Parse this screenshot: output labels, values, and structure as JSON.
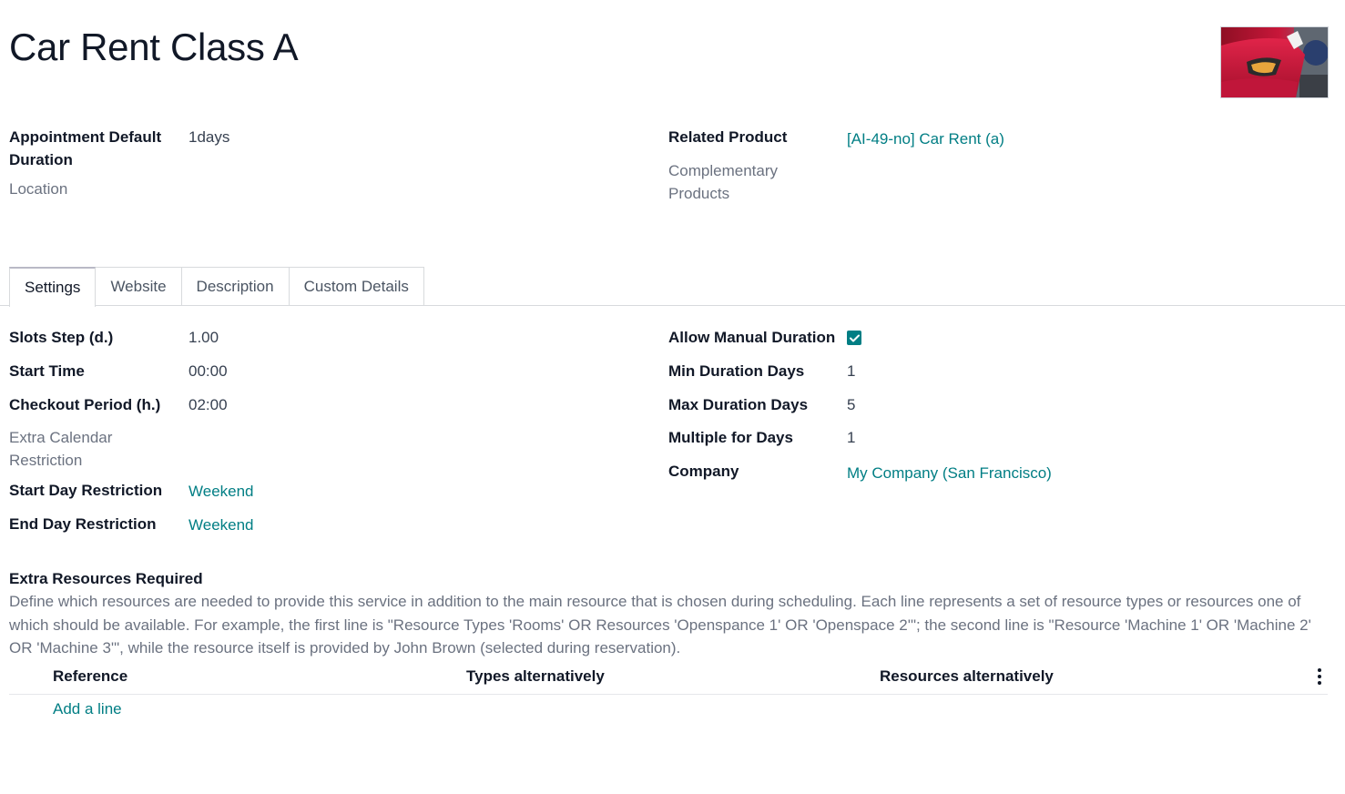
{
  "record": {
    "title": "Car Rent Class A"
  },
  "header_fields": {
    "appointment_default_duration_label": "Appointment Default Duration",
    "appointment_default_duration_value": "1days",
    "location_label": "Location",
    "related_product_label": "Related Product",
    "related_product_value": "[AI-49-no] Car Rent (a)",
    "complementary_products_label": "Complementary Products"
  },
  "tabs": [
    {
      "label": "Settings",
      "active": true
    },
    {
      "label": "Website",
      "active": false
    },
    {
      "label": "Description",
      "active": false
    },
    {
      "label": "Custom Details",
      "active": false
    }
  ],
  "settings": {
    "slots_step_label": "Slots Step (d.)",
    "slots_step_value": "1.00",
    "start_time_label": "Start Time",
    "start_time_value": "00:00",
    "checkout_period_label": "Checkout Period (h.)",
    "checkout_period_value": "02:00",
    "extra_calendar_label": "Extra Calendar Restriction",
    "start_day_restriction_label": "Start Day Restriction",
    "start_day_restriction_value": "Weekend",
    "end_day_restriction_label": "End Day Restriction",
    "end_day_restriction_value": "Weekend",
    "allow_manual_duration_label": "Allow Manual Duration",
    "allow_manual_duration_checked": true,
    "min_duration_days_label": "Min Duration Days",
    "min_duration_days_value": "1",
    "max_duration_days_label": "Max Duration Days",
    "max_duration_days_value": "5",
    "multiple_for_days_label": "Multiple for Days",
    "multiple_for_days_value": "1",
    "company_label": "Company",
    "company_value": "My Company (San Francisco)"
  },
  "extra_resources": {
    "title": "Extra Resources Required",
    "description": "Define which resources are needed to provide this service in addition to the main resource that is chosen during scheduling. Each line represents a set of resource types or resources one of which should be available. For example, the first line is \"Resource Types 'Rooms' OR Resources 'Openspance 1' OR 'Openspace 2'\"; the second line is \"Resource 'Machine 1' OR 'Machine 2' OR 'Machine 3'\", while the resource itself is provided by John Brown (selected during reservation).",
    "columns": [
      "Reference",
      "Types alternatively",
      "Resources alternatively"
    ],
    "add_line_label": "Add a line"
  },
  "colors": {
    "accent": "#017e84",
    "label": "#111827",
    "muted": "#6b7280"
  },
  "icons": {
    "checkbox": "check-icon",
    "options": "kebab-menu-icon"
  }
}
